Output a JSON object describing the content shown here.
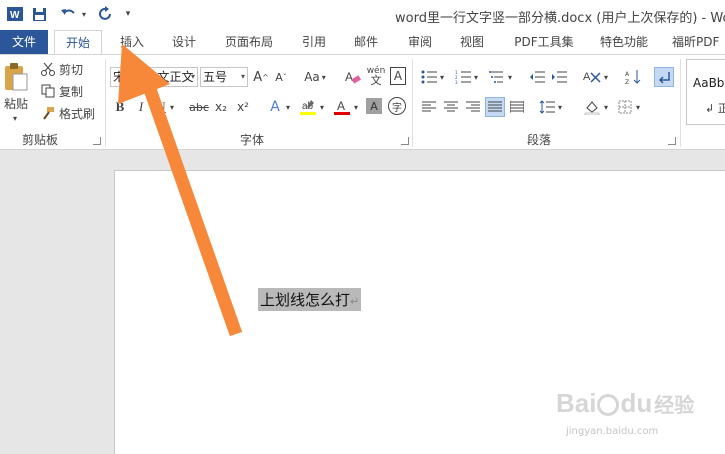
{
  "window": {
    "title": "word里一行文字竖一部分横.docx (用户上次保存的) - Word(",
    "app_icon": "word-app-icon"
  },
  "quick_access": {
    "customize_glyph": "▾"
  },
  "tabs": [
    {
      "label": "文件"
    },
    {
      "label": "开始"
    },
    {
      "label": "插入"
    },
    {
      "label": "设计"
    },
    {
      "label": "页面布局"
    },
    {
      "label": "引用"
    },
    {
      "label": "邮件"
    },
    {
      "label": "审阅"
    },
    {
      "label": "视图"
    },
    {
      "label": "PDF工具集"
    },
    {
      "label": "特色功能"
    },
    {
      "label": "福昕PDF"
    }
  ],
  "clipboard": {
    "paste": "粘贴",
    "cut": "剪切",
    "copy": "复制",
    "format_painter": "格式刷",
    "group_label": "剪贴板"
  },
  "font": {
    "font_name": "宋体 (中文正文",
    "font_size": "五号",
    "bold": "B",
    "italic": "I",
    "underline": "U",
    "strikethrough": "abc",
    "subscript": "x₂",
    "superscript": "x²",
    "change_case": "Aa",
    "char_border": "A",
    "char_shading": "A",
    "font_color": "A",
    "effects": "A",
    "enclose": "字",
    "phonetic": "wén",
    "group_label": "字体",
    "highlight_color": "#ffff00",
    "font_color_value": "#e00000"
  },
  "paragraph": {
    "group_label": "段落"
  },
  "styles": {
    "sample": "AaBbC",
    "sample_sub": "↲ 正"
  },
  "document": {
    "selected_text": "上划线怎么打",
    "para_mark": "↵"
  },
  "annotation": {
    "arrow_color": "#f7883a"
  },
  "watermark": {
    "brand": "Bai",
    "brand2": "du",
    "cn": "经验",
    "url": "jingyan.baidu.com"
  }
}
